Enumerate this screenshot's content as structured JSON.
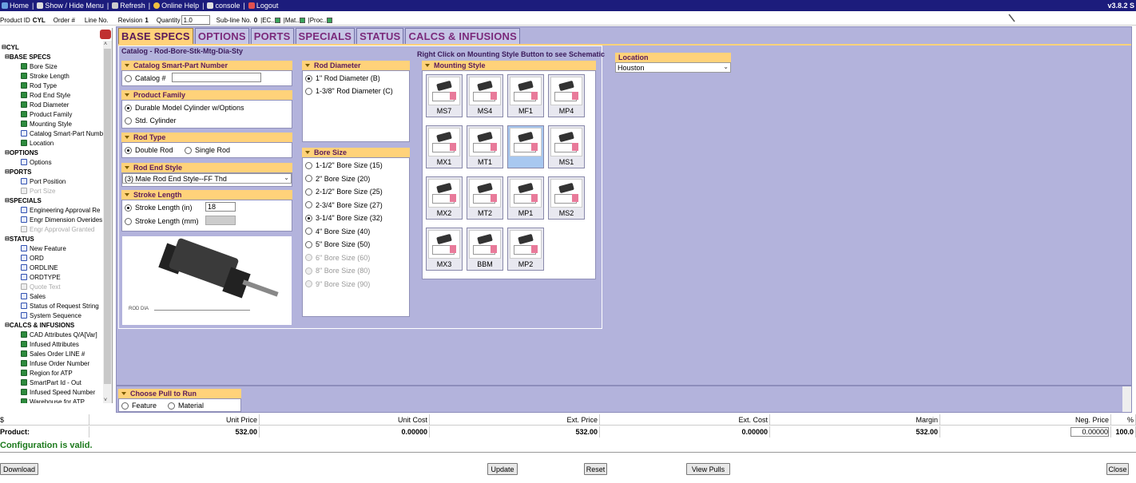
{
  "topbar": {
    "items": [
      "Home",
      "Show / Hide Menu",
      "Refresh",
      "Online Help",
      "console",
      "Logout"
    ],
    "version": "v3.8.2 S"
  },
  "infobar": {
    "product_id_label": "Product ID",
    "product_id": "CYL",
    "order_label": "Order #",
    "line_label": "Line No.",
    "revision_label": "Revision",
    "revision": "1",
    "quantity_label": "Quantity",
    "quantity": "1.0",
    "subline_label": "Sub-line No.",
    "subline": "0",
    "ec_label": "|EC..",
    "mat_label": "|Mat..",
    "proc_label": "|Proc.."
  },
  "tree": {
    "root": "CYL",
    "groups": [
      {
        "label": "BASE SPECS",
        "items": [
          {
            "label": "Bore Size",
            "kind": "green"
          },
          {
            "label": "Stroke Length",
            "kind": "green"
          },
          {
            "label": "Rod Type",
            "kind": "green"
          },
          {
            "label": "Rod End Style",
            "kind": "green"
          },
          {
            "label": "Rod Diameter",
            "kind": "green"
          },
          {
            "label": "Product Family",
            "kind": "green"
          },
          {
            "label": "Mounting Style",
            "kind": "green"
          },
          {
            "label": "Catalog Smart-Part Numb",
            "kind": "blue"
          },
          {
            "label": "Location",
            "kind": "green"
          }
        ]
      },
      {
        "label": "OPTIONS",
        "items": [
          {
            "label": "Options",
            "kind": "blue"
          }
        ]
      },
      {
        "label": "PORTS",
        "items": [
          {
            "label": "Port Position",
            "kind": "blue"
          },
          {
            "label": "Port Size",
            "kind": "gray"
          }
        ]
      },
      {
        "label": "SPECIALS",
        "items": [
          {
            "label": "Engineering Approval Re",
            "kind": "blue"
          },
          {
            "label": "Engr Dimension Overides",
            "kind": "blue"
          },
          {
            "label": "Engr Approval Granted",
            "kind": "gray"
          }
        ]
      },
      {
        "label": "STATUS",
        "items": [
          {
            "label": "New Feature",
            "kind": "blue"
          },
          {
            "label": "ORD",
            "kind": "blue"
          },
          {
            "label": "ORDLINE",
            "kind": "blue"
          },
          {
            "label": "ORDTYPE",
            "kind": "blue"
          },
          {
            "label": "Quote Text",
            "kind": "gray"
          },
          {
            "label": "Sales",
            "kind": "blue"
          },
          {
            "label": "Status of Request String",
            "kind": "blue"
          },
          {
            "label": "System Sequence",
            "kind": "blue"
          }
        ]
      },
      {
        "label": "CALCS & INFUSIONS",
        "items": [
          {
            "label": "CAD Attributes  Q/A[Var]",
            "kind": "green"
          },
          {
            "label": "Infused Attributes",
            "kind": "green"
          },
          {
            "label": "Sales Order LINE #",
            "kind": "green"
          },
          {
            "label": "Infuse Order Number",
            "kind": "green"
          },
          {
            "label": "Region for ATP",
            "kind": "green"
          },
          {
            "label": "SmartPart Id - Out",
            "kind": "green"
          },
          {
            "label": "Infused Speed Number",
            "kind": "green"
          },
          {
            "label": "Warehouse for ATP",
            "kind": "green"
          }
        ]
      }
    ]
  },
  "tabs": [
    "BASE SPECS",
    "OPTIONS",
    "PORTS",
    "SPECIALS",
    "STATUS",
    "CALCS & INFUSIONS"
  ],
  "catalog_label": "Catalog - Rod-Bore-Stk-Mtg-Dia-Sty",
  "right_note": "Right Click on Mounting Style Button to see Schematic",
  "catalog_smart": {
    "title": "Catalog Smart-Part Number",
    "option": "Catalog #",
    "value": ""
  },
  "product_family": {
    "title": "Product Family",
    "options": [
      "Durable Model Cylinder w/Options",
      "Std. Cylinder"
    ],
    "selected": 0
  },
  "rod_type": {
    "title": "Rod Type",
    "options": [
      "Double Rod",
      "Single Rod"
    ],
    "selected": 0
  },
  "rod_end_style": {
    "title": "Rod End Style",
    "value": "(3)  Male Rod End Style--FF Thd"
  },
  "stroke_length": {
    "title": "Stroke Length",
    "in_label": "Stroke Length (in)",
    "in_value": "18",
    "mm_label": "Stroke Length (mm)"
  },
  "cyl_dims": "ROD\nDIA",
  "rod_diameter": {
    "title": "Rod Diameter",
    "options": [
      "1\" Rod Diameter  (B)",
      "1-3/8\" Rod Diameter  (C)"
    ],
    "selected": 0
  },
  "bore_size": {
    "title": "Bore Size",
    "options": [
      {
        "label": "1-1/2\" Bore Size  (15)",
        "enabled": true
      },
      {
        "label": "2\" Bore Size   (20)",
        "enabled": true
      },
      {
        "label": "2-1/2\" Bore Size  (25)",
        "enabled": true
      },
      {
        "label": "2-3/4\" Bore Size  (27)",
        "enabled": true
      },
      {
        "label": "3-1/4\" Bore Size  (32)",
        "enabled": true
      },
      {
        "label": "4\" Bore Size  (40)",
        "enabled": true
      },
      {
        "label": "5\" Bore Size  (50)",
        "enabled": true
      },
      {
        "label": "6\" Bore Size  (60)",
        "enabled": false
      },
      {
        "label": "8\" Bore Size  (80)",
        "enabled": false
      },
      {
        "label": "9\" Bore Size  (90)",
        "enabled": false
      }
    ],
    "selected": 4
  },
  "mounting": {
    "title": "Mounting Style",
    "styles": [
      "MS7",
      "MS4",
      "MF1",
      "MP4",
      "MX1",
      "MT1",
      "",
      "MS1",
      "MX2",
      "MT2",
      "MP1",
      "MS2",
      "MX3",
      "BBM",
      "MP2"
    ],
    "selected": 6
  },
  "location": {
    "title": "Location",
    "value": "Houston"
  },
  "pull": {
    "title": "Choose Pull to Run",
    "options": [
      "Feature",
      "Material"
    ]
  },
  "prices": {
    "currency": "$",
    "headers": [
      "Unit Price",
      "Unit Cost",
      "Ext. Price",
      "Ext. Cost",
      "Margin",
      "Neg. Price",
      "%"
    ],
    "row_label": "Product:",
    "unit_price": "532.00",
    "unit_cost": "0.00000",
    "ext_price": "532.00",
    "ext_cost": "0.00000",
    "margin": "532.00",
    "neg_price": "0.00000",
    "percent": "100.0"
  },
  "status_text": "Configuration is valid.",
  "buttons": {
    "download": "Download",
    "update": "Update",
    "reset": "Reset",
    "view_pulls": "View Pulls",
    "close": "Close"
  }
}
